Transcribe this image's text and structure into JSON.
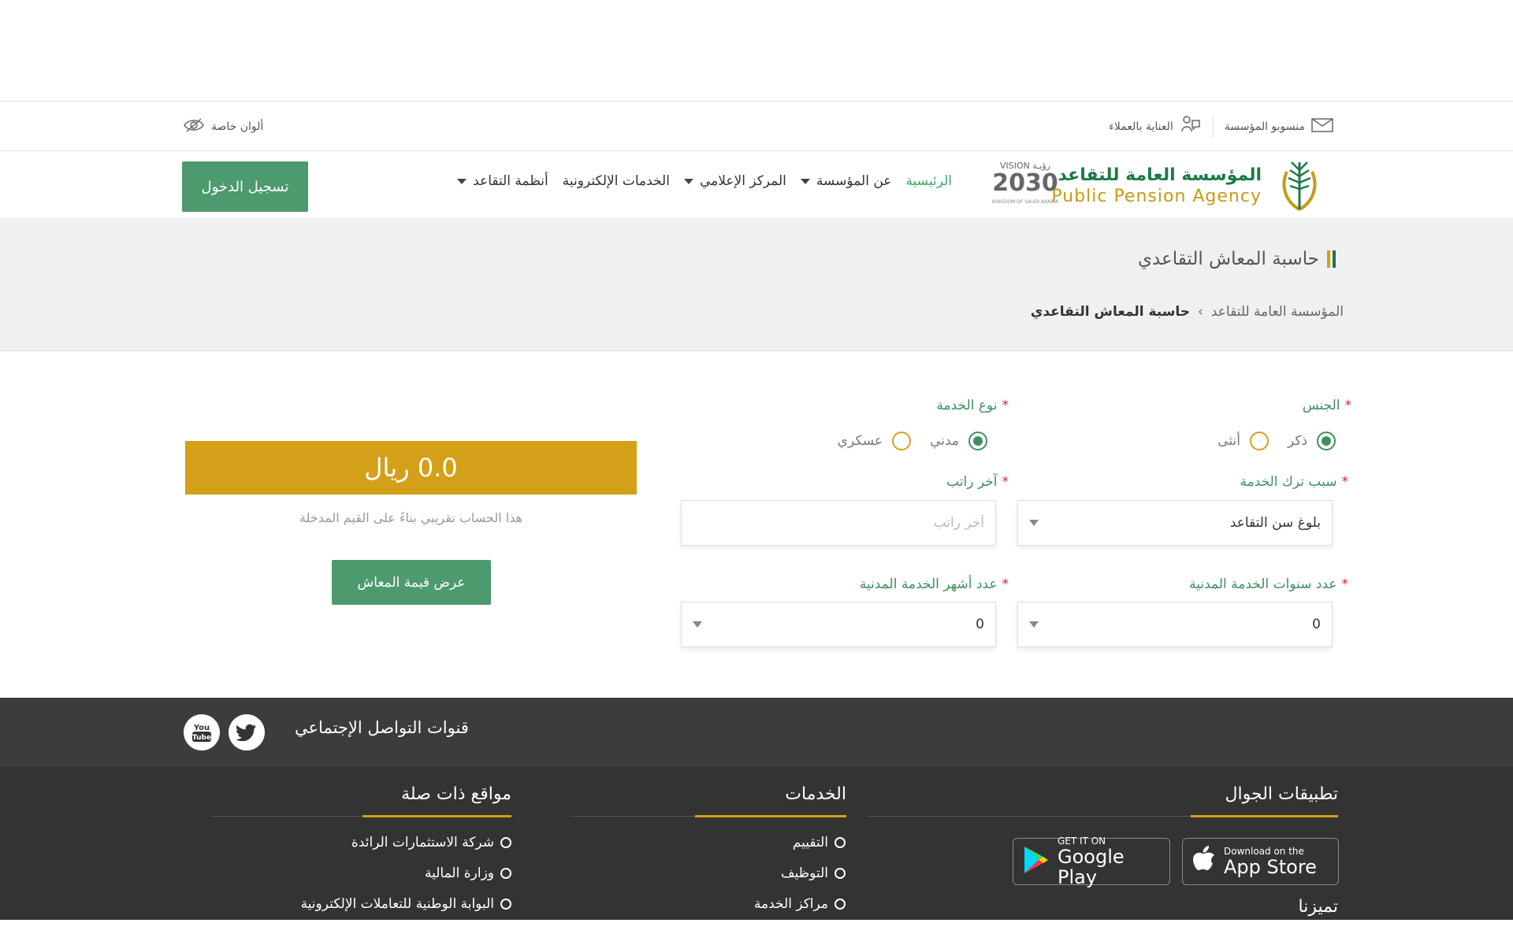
{
  "topbar": {
    "staff_label": "منسوبو المؤسسة",
    "care_label": "العناية بالعملاء",
    "special_colors_label": "ألوان خاصة"
  },
  "brand": {
    "name_ar": "المؤسسة العامة للتقاعد",
    "name_en": "Public Pension Agency",
    "vision_top": "VISION رؤيـة",
    "vision_year": "2030",
    "vision_sub": "KINGDOM OF SAUDI ARABIA"
  },
  "nav": {
    "items": [
      {
        "label": "الرئيسية",
        "dropdown": false,
        "active": true
      },
      {
        "label": "عن المؤسسة",
        "dropdown": true,
        "active": false
      },
      {
        "label": "المركز الإعلامي",
        "dropdown": true,
        "active": false
      },
      {
        "label": "الخدمات الإلكترونية",
        "dropdown": false,
        "active": false
      },
      {
        "label": "أنظمة التقاعد",
        "dropdown": true,
        "active": false
      }
    ],
    "login_label": "تسجيل الدخول"
  },
  "page": {
    "title": "حاسبة المعاش التقاعدي",
    "breadcrumb_root": "المؤسسة العامة للتقاعد",
    "breadcrumb_sep": "›",
    "breadcrumb_current": "حاسبة المعاش التقاعدي"
  },
  "form": {
    "required_mark": "*",
    "gender_label": "الجنس",
    "gender_male": "ذكر",
    "gender_female": "أنثى",
    "gender_selected": "ذكر",
    "service_type_label": "نوع الخدمة",
    "service_civil": "مدني",
    "service_military": "عسكري",
    "service_selected": "مدني",
    "leave_reason_label": "سبب ترك الخدمة",
    "leave_reason_value": "بلوغ سن التقاعد",
    "last_salary_label": "آخر راتب",
    "last_salary_placeholder": "آخر راتب",
    "last_salary_value": "",
    "years_label": "عدد سنوات الخدمة المدنية",
    "years_value": "0",
    "months_label": "عدد أشهر الخدمة المدنية",
    "months_value": "0"
  },
  "result": {
    "amount": "0.0 ريال",
    "note": "هذا الحساب تقريبي بناءً على القيم المدخلة",
    "show_button": "عرض قيمة المعاش"
  },
  "social": {
    "title": "قنوات التواصل الإجتماعي",
    "youtube_label": "You Tube"
  },
  "footer": {
    "apps_title": "تطبيقات الجوال",
    "services_title": "الخدمات",
    "related_title": "مواقع ذات صلة",
    "features_title": "تميزنا",
    "services_links": [
      "التقييم",
      "التوظيف",
      "مراكز الخدمة"
    ],
    "related_links": [
      "شركة الاستثمارات الرائدة",
      "وزارة المالية",
      "البوابة الوطنية للتعاملات الإلكترونية"
    ],
    "appstore_small": "Download on the",
    "appstore_big": "App Store",
    "googleplay_small": "GET IT ON",
    "googleplay_big": "Google Play"
  },
  "colors": {
    "brand_green": "#3e8f60",
    "button_green": "#4c9a6e",
    "gold": "#d4a017",
    "footer_dark": "#333333",
    "social_band": "#3c3c3c"
  }
}
